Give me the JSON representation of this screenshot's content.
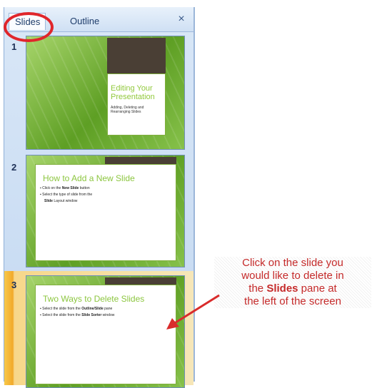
{
  "tabs": [
    {
      "label": "Slides",
      "active": true
    },
    {
      "label": "Outline",
      "active": false
    }
  ],
  "close_glyph": "×",
  "slides": [
    {
      "number": "1",
      "title": "Editing Your Presentation",
      "subtitle": "Adding, Deleting and Rearranging Slides",
      "selected": false
    },
    {
      "number": "2",
      "title": "How to Add a New Slide",
      "bullets": [
        {
          "pre": "Click on the ",
          "bold": "New Slide",
          "post": " button"
        },
        {
          "pre": "Select the type of slide from the",
          "bold": "",
          "post": ""
        },
        {
          "pre": "",
          "bold": "Slide",
          "post": " Layout window"
        }
      ],
      "selected": false
    },
    {
      "number": "3",
      "title": "Two Ways to Delete Slides",
      "bullets": [
        {
          "pre": "Select the slide from the ",
          "bold": "Outline/Slide",
          "post": " pane"
        },
        {
          "pre": "Select the slide from the ",
          "bold": "Slide Sorter",
          "post": " window"
        }
      ],
      "selected": true
    }
  ],
  "callout": {
    "line1": "Click on the slide you",
    "line2": "would like to delete in",
    "line3_pre": "the ",
    "line3_bold": "Slides",
    "line3_post": " pane at",
    "line4": "the left of the screen"
  },
  "colors": {
    "accent_red": "#e0262b",
    "slide_green": "#7fbf3a",
    "selection_orange": "#f2a92a",
    "pane_blue": "#c3d8f1"
  },
  "icons": {
    "close": "close-icon",
    "annotation_circle": "red-circle-highlight",
    "annotation_arrow": "red-arrow"
  }
}
